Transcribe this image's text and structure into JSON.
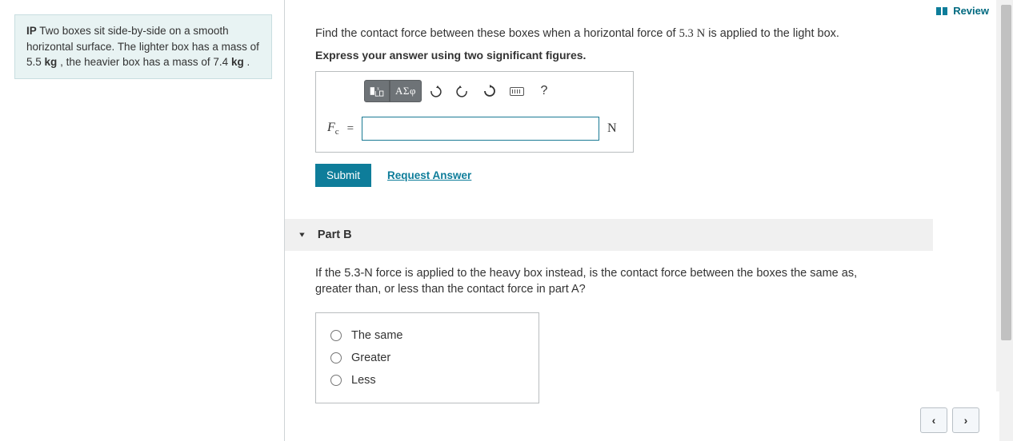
{
  "header": {
    "review": "Review"
  },
  "info": {
    "prefix": "IP",
    "text1": " Two boxes sit side-by-side on a smooth horizontal surface. The lighter box has a mass of ",
    "mass1": "5.5",
    "unit1": "kg",
    "text2": " , the heavier box has a mass of ",
    "mass2": "7.4",
    "unit2": "kg",
    "text3": " ."
  },
  "partA": {
    "prompt_pre": "Find the contact force between these boxes when a horizontal force of ",
    "force_val": "5.3",
    "force_unit": "N",
    "prompt_post": " is applied to the light box.",
    "instruction": "Express your answer using two significant figures.",
    "var_label": "F",
    "var_sub": "c",
    "equals": "=",
    "unit": "N",
    "submit": "Submit",
    "request": "Request Answer",
    "toolbar": {
      "greek": "ΑΣφ",
      "help": "?"
    }
  },
  "partB": {
    "header": "Part B",
    "prompt_pre": "If the ",
    "force": "5.3-",
    "force_unit": "N",
    "prompt_post": " force is applied to the heavy box instead, is the contact force between the boxes the same as, greater than, or less than the contact force in part A?",
    "options": [
      "The same",
      "Greater",
      "Less"
    ]
  },
  "nav": {
    "prev": "‹",
    "next": "›"
  }
}
